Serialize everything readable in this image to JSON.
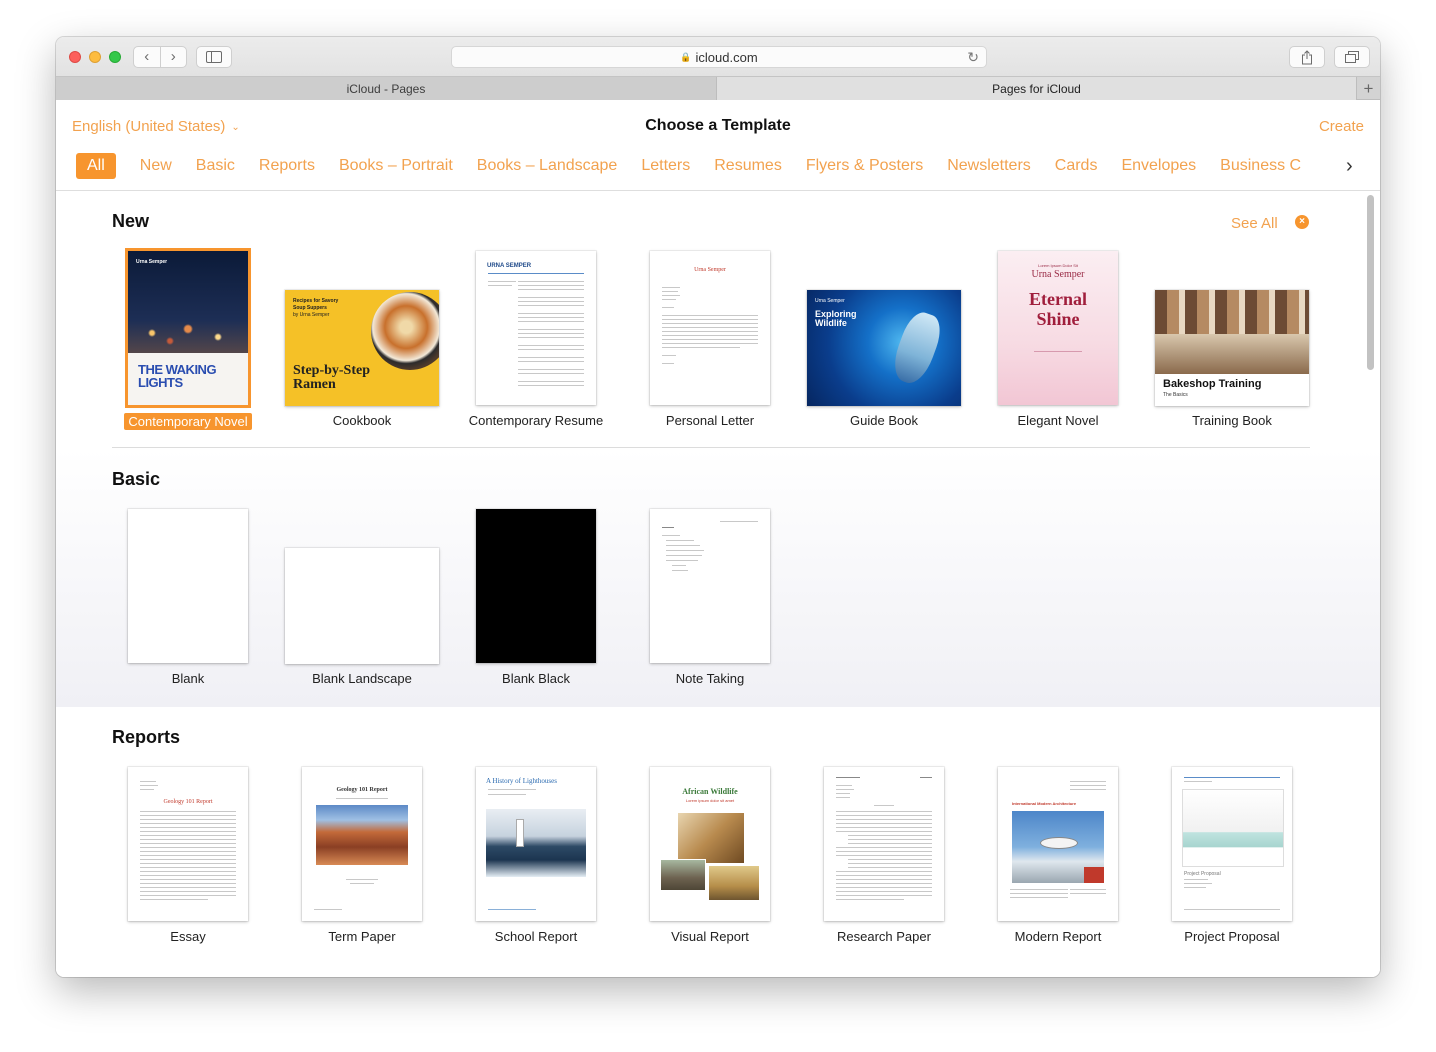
{
  "browser": {
    "url": "icloud.com",
    "tabs": [
      {
        "label": "iCloud - Pages"
      },
      {
        "label": "Pages for iCloud"
      }
    ],
    "new_tab_symbol": "+"
  },
  "header": {
    "language": "English (United States)",
    "title": "Choose a Template",
    "create_label": "Create"
  },
  "categories": [
    "All",
    "New",
    "Basic",
    "Reports",
    "Books – Portrait",
    "Books – Landscape",
    "Letters",
    "Resumes",
    "Flyers & Posters",
    "Newsletters",
    "Cards",
    "Envelopes",
    "Business C"
  ],
  "sections": {
    "new": {
      "title": "New",
      "see_all": "See All",
      "templates": [
        {
          "label": "Contemporary Novel",
          "cover_author": "Urna Semper",
          "cover_title": "THE WAKING LIGHTS"
        },
        {
          "label": "Cookbook",
          "cover_kicker": "Recipes for Savory Soup Suppers",
          "cover_author": "by Urna Semper",
          "cover_title": "Step-by-Step Ramen"
        },
        {
          "label": "Contemporary Resume",
          "cover_name": "URNA SEMPER"
        },
        {
          "label": "Personal Letter",
          "cover_name": "Urna Semper"
        },
        {
          "label": "Guide Book",
          "cover_author": "Urna Semper",
          "cover_title": "Exploring Wildlife"
        },
        {
          "label": "Elegant Novel",
          "cover_kicker": "Lorem Ipsum Dolor Sit",
          "cover_author": "Urna Semper",
          "cover_title": "Eternal Shine"
        },
        {
          "label": "Training Book",
          "cover_title": "Bakeshop Training",
          "cover_subtitle": "The Basics"
        }
      ]
    },
    "basic": {
      "title": "Basic",
      "templates": [
        {
          "label": "Blank"
        },
        {
          "label": "Blank Landscape"
        },
        {
          "label": "Blank Black"
        },
        {
          "label": "Note Taking"
        }
      ]
    },
    "reports": {
      "title": "Reports",
      "templates": [
        {
          "label": "Essay",
          "cover_title": "Geology 101 Report"
        },
        {
          "label": "Term Paper",
          "cover_title": "Geology 101 Report"
        },
        {
          "label": "School Report",
          "cover_title": "A History of Lighthouses"
        },
        {
          "label": "Visual Report",
          "cover_title": "African Wildlife",
          "cover_subtitle": "Lorem ipsum dolor sit amet"
        },
        {
          "label": "Research Paper"
        },
        {
          "label": "Modern Report",
          "cover_title": "International Modern Architecture"
        },
        {
          "label": "Project Proposal",
          "cover_title": "Project Proposal"
        }
      ]
    }
  },
  "colors": {
    "accent": "#f7952e",
    "accent_text": "#f2a24f"
  }
}
